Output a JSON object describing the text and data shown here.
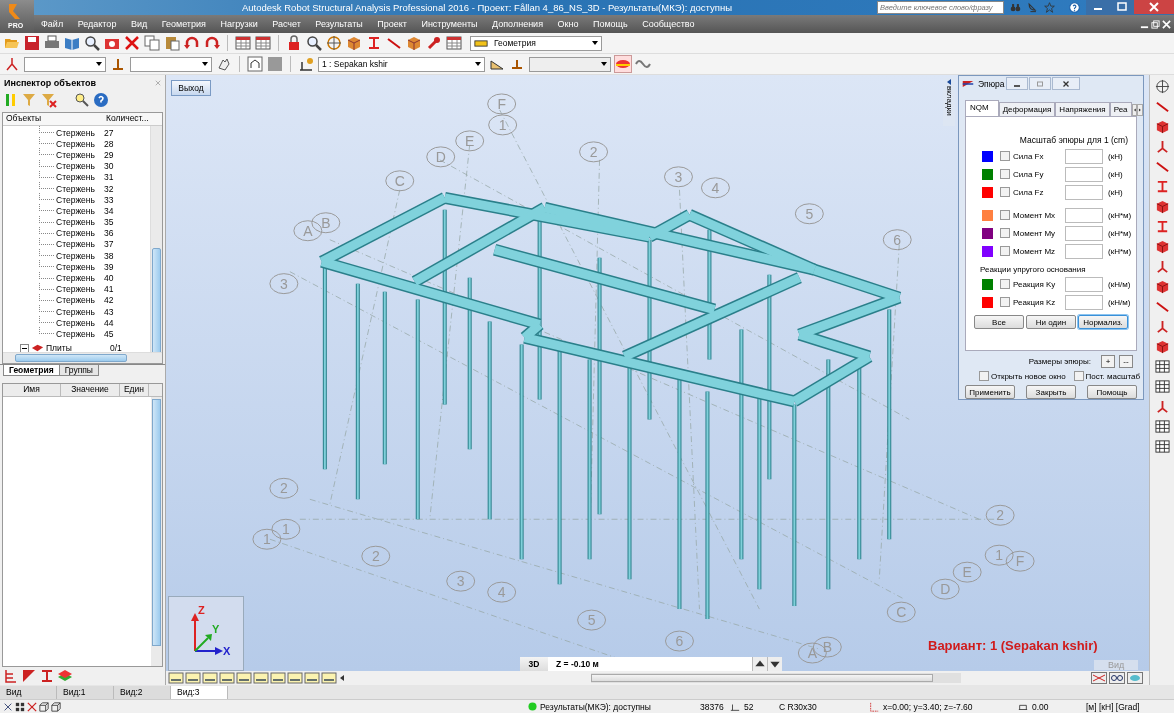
{
  "window": {
    "title": "Autodesk Robot Structural Analysis Professional 2016 - Проект: Fållan 4_86_NS_3D - Результаты(МКЭ): доступны",
    "logo_badge": "PRO",
    "search": {
      "placeholder": "Введите ключевое слово/фразу"
    }
  },
  "menu": [
    "Файл",
    "Редактор",
    "Вид",
    "Геометрия",
    "Нагрузки",
    "Расчет",
    "Результаты",
    "Проект",
    "Инструменты",
    "Дополнения",
    "Окно",
    "Помощь",
    "Сообщество"
  ],
  "toolbar": {
    "layer_select": "Геометрия",
    "case_select": "1 : Sepakan kshir"
  },
  "inspector": {
    "title": "Инспектор объектов",
    "columns": [
      "Объекты",
      "Количест..."
    ],
    "rows": [
      {
        "label": "Стержень",
        "count": "27"
      },
      {
        "label": "Стержень",
        "count": "28"
      },
      {
        "label": "Стержень",
        "count": "29"
      },
      {
        "label": "Стержень",
        "count": "30"
      },
      {
        "label": "Стержень",
        "count": "31"
      },
      {
        "label": "Стержень",
        "count": "32"
      },
      {
        "label": "Стержень",
        "count": "33"
      },
      {
        "label": "Стержень",
        "count": "34"
      },
      {
        "label": "Стержень",
        "count": "35"
      },
      {
        "label": "Стержень",
        "count": "36"
      },
      {
        "label": "Стержень",
        "count": "37"
      },
      {
        "label": "Стержень",
        "count": "38"
      },
      {
        "label": "Стержень",
        "count": "39"
      },
      {
        "label": "Стержень",
        "count": "40"
      },
      {
        "label": "Стержень",
        "count": "41"
      },
      {
        "label": "Стержень",
        "count": "42"
      },
      {
        "label": "Стержень",
        "count": "43"
      },
      {
        "label": "Стержень",
        "count": "44"
      },
      {
        "label": "Стержень",
        "count": "45"
      }
    ],
    "group": {
      "label": "Плиты",
      "count": "0/1",
      "expanded": true
    },
    "tabs": [
      {
        "label": "Геометрия",
        "selected": true
      },
      {
        "label": "Группы",
        "selected": false
      }
    ],
    "table_columns": [
      "Имя",
      "Значение",
      "Един"
    ]
  },
  "view": {
    "exit_button": "Выход",
    "side_tab": "вкладки",
    "grid_labels": [
      "F",
      "1",
      "E",
      "D",
      "2",
      "C",
      "3",
      "4",
      "B",
      "A",
      "5",
      "6",
      "3",
      "2",
      "1",
      "1",
      "2",
      "3",
      "4",
      "5",
      "6",
      "2",
      "1",
      "F",
      "E",
      "D",
      "C",
      "B",
      "A"
    ],
    "axes": [
      "Z",
      "Y",
      "X"
    ],
    "view_mode": "3D",
    "level": "Z = -0.10 м",
    "view_caption": "Вид",
    "variant": "Вариант: 1 (Sepakan kshir)"
  },
  "dialog": {
    "title": "Эпюра",
    "tabs": [
      {
        "label": "NQM",
        "selected": true
      },
      {
        "label": "Деформация",
        "selected": false
      },
      {
        "label": "Напряжения",
        "selected": false
      },
      {
        "label": "Реа",
        "selected": false
      }
    ],
    "scale_label": "Масштаб эпюры для 1  (cm)",
    "groups": [
      {
        "rows": [
          {
            "label": "Сила Fx",
            "color": "#0000ff",
            "checked": false,
            "unit": "(кН)"
          },
          {
            "label": "Сила Fy",
            "color": "#008000",
            "checked": false,
            "unit": "(кН)"
          },
          {
            "label": "Сила Fz",
            "color": "#ff0000",
            "checked": false,
            "unit": "(кН)"
          }
        ]
      },
      {
        "rows": [
          {
            "label": "Момент Mx",
            "color": "#ff8040",
            "checked": false,
            "unit": "(кН*м)"
          },
          {
            "label": "Момент My",
            "color": "#800080",
            "checked": false,
            "unit": "(кН*м)"
          },
          {
            "label": "Момент Mz",
            "color": "#8000ff",
            "checked": false,
            "unit": "(кН*м)"
          }
        ]
      },
      {
        "title": "Реакции упругого основания",
        "rows": [
          {
            "label": "Реакция Ky",
            "color": "#008000",
            "checked": false,
            "unit": "(кН/м)"
          },
          {
            "label": "Реакция Kz",
            "color": "#ff0000",
            "checked": false,
            "unit": "(кН/м)"
          }
        ]
      }
    ],
    "select_buttons": [
      {
        "label": "Все",
        "focused": false
      },
      {
        "label": "Ни один",
        "focused": false
      },
      {
        "label": "Нормализ.",
        "focused": true
      }
    ],
    "size_label": "Размеры эпюры:",
    "size_buttons": [
      "+",
      "--"
    ],
    "options": [
      {
        "label": "Открыть новое окно",
        "checked": false
      },
      {
        "label": "Пост. масштаб",
        "checked": false
      }
    ],
    "footer_buttons": [
      "Применить",
      "Закрыть",
      "Помощь"
    ]
  },
  "view_tabs": [
    {
      "label": "Вид",
      "selected": false
    },
    {
      "label": "Вид:1",
      "selected": false
    },
    {
      "label": "Вид:2",
      "selected": false
    },
    {
      "label": "Вид:3",
      "selected": true
    }
  ],
  "status_bar": {
    "text": "Результаты(МКЭ): доступны",
    "nodes": "38376",
    "bars": "52",
    "section": "C R30x30",
    "coords": "x=0.00; y=3.40; z=-7.60",
    "angle": "0.00",
    "units": "[м] [кН] [Grad]"
  }
}
